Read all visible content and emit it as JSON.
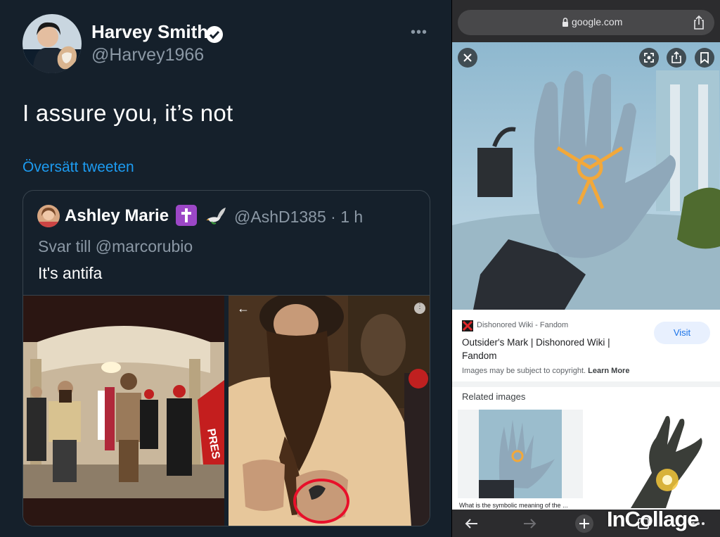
{
  "tweet": {
    "author_name": "Harvey Smith",
    "author_handle": "@Harvey1966",
    "text": "I assure you, it’s not",
    "translate_label": "Översätt tweeten",
    "colors": {
      "background": "#15202b",
      "link": "#1d9bf0",
      "secondary_text": "#8b98a5"
    }
  },
  "quoted_tweet": {
    "author_name": "Ashley Marie",
    "handle_time": "@AshD1385 · 1 h",
    "reply_to": "Svar till @marcorubio",
    "text": "It's antifa",
    "photo_right_sign_text": "PRES"
  },
  "browser": {
    "url": "google.com",
    "source_name": "Dishonored Wiki - Fandom",
    "result_title": "Outsider's Mark | Dishonored Wiki | Fandom",
    "visit_label": "Visit",
    "copyright_note": "Images may be subject to copyright.",
    "learn_more_label": "Learn More",
    "related_title": "Related images",
    "related_caption": "What is the symbolic meaning of the ..."
  },
  "watermark": "InCollage"
}
